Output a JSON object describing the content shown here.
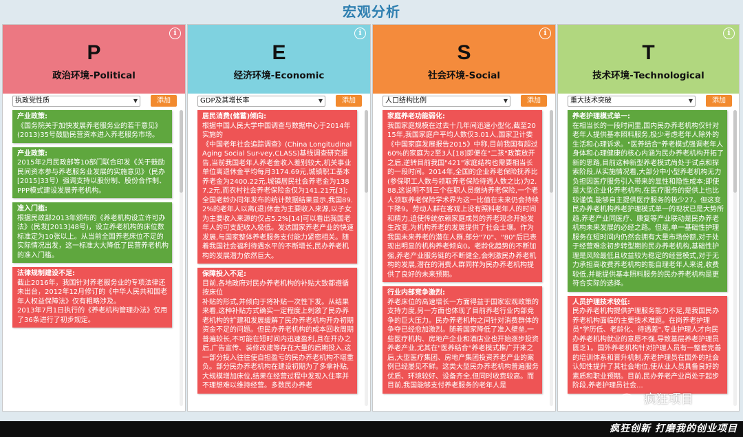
{
  "page": {
    "title": "宏观分析"
  },
  "colors": {
    "political": "#ec7882",
    "economic": "#7fd2e0",
    "social": "#f48b3c",
    "technological": "#b1d77f",
    "card_green": "#5fa73e",
    "card_red": "#ee5455",
    "button": "#f28a2e"
  },
  "columns": [
    {
      "letter": "P",
      "subtitle": "政治环境-Political",
      "select_value": "执政党性质",
      "add_label": "添加",
      "cards": [
        {
          "color": "green",
          "title": "产业政策:",
          "body": "《国务院关于加快发展养老服务业的若干意见》(2013)35号鼓励民营资本进入养老服务市场。"
        },
        {
          "color": "green",
          "title": "产业政策:",
          "body": "2015年2月民政部等10部门联合印发《关于鼓励民间资本参与养老服务业发展的实施意见》（民办[2015]33号）强调支持以股份制、股份合作制、PPP模式建设发展养老机构。"
        },
        {
          "color": "green",
          "title": "准入门槛:",
          "body": "根据民政部2013年颁布的《养老机构设立许可办法》(民发[2013]48号)，设立养老机构的床位数标准定为10张以上。从当前全国养老床位不足的实际情况出发，这一标准大大降低了民营养老机构的准入门槛。"
        },
        {
          "color": "red",
          "title": "法律规制建设不足:",
          "body": "截止2016年，我国针对养老服务业的专项法律还未出台，2012年12月修订的《中华人民共和国老年人权益保障法》仅有粗略涉及。\n2013年7月1日执行的《养老机构管理办法》仅用了36条进行了初步规定。"
        }
      ]
    },
    {
      "letter": "E",
      "subtitle": "经济环境-Economic",
      "select_value": "GDP及其增长率",
      "add_label": "添加",
      "cards": [
        {
          "color": "red",
          "title": "居民消费(储蓄)倾向:",
          "body": "根据中国人民大学中国调查与数据中心于2014年实施的\n《中国老年社会追踪调查》(China Longitudinal Aging Social Sur-vey,CLASS)基线调查研究报告,当前我国老年人养老金收入差别较大,机关事业单位离退休金平均每月3174.69元,城镇职工基本养老金为2400.22元,城镇居民社会养老金为1387.2元,而农村社会养老保险金仅为141.21元[3];全国老龄办同年发布的统计数据结果显示,我国89.2%的老年人以离(退)休金为主要收入来源,以子女为主要收入来源的仅占5.2%[14]可以看出我国老年人的可支配收入极低。发达国家养老产业的快速发展,与国家整体养老服务支付能力紧密相关。随着我国社会福利待遇水平的不断增长,民办养老机构的发展潜力依然巨大。"
        },
        {
          "color": "red",
          "title": "保障投入不足:",
          "body": "目前,各地政府对民办养老机构的补贴大致都遵循按床位\n补贴的形式,并倾向于将补贴一次性下发。从结果来看,这种补贴方式确实一定程度上刺激了民办养老机构的扩建和发展缓解了民办养老机构开办初期资金不足的问题。但民办养老机构的成本回收周期普遍较长,不可能在短时间内迅速盈利,且在开办之后,广告宣传、装修改建等存在大量的后期投入,这一部分投入往往使自担盈亏的民办养老机构不堪重负。部分民办养老机构在建设初期为了多拿补贴,大规模增加床位,结果在经营过程中发现入住率并不理想难以维持经营。多数民办养老"
        }
      ]
    },
    {
      "letter": "S",
      "subtitle": "社会环境-Social",
      "select_value": "人口结构比例",
      "add_label": "添加",
      "cards": [
        {
          "color": "red",
          "title": "家庭养老功能弱化:",
          "body": "我国家庭规模在过去十几年间迅速小型化,截至2015年,我国家庭户平均人数仅3.01人,国家卫计委《中国家庭发展报告2015》中称,目前我国有超过60%的家庭为2至3人[18]即便在\"二孩\"政策放开之后,逆转目前我国\"421\"家庭结构也需要相当长的一段时间。2014年,全国的企业养老保险抚养比(参保职工人数与领取养老保险待遇人数之比)为2.88,这说明不到三个在职人员缴纳养老保险,一个老人领取养老保险学术界为这一比值在未来仍会持续下降9。劳动人群在客观上没有照料老年人的时间和精力,迫使传统依赖家庭成员的养老观念开始发生改变,为机构养老的发展提供了社会土壤。作为我国未来养老的潜在人群,部分\"70\"、\"80\"后已表现出明显的机构养老倾向0。老龄化趋势的不断加强,养老产业服务链的不断健全,会刺激民办养老机构的发展,潜在的消费人群同样为民办养老机构提供了良好的未来预期。"
        },
        {
          "color": "red",
          "title": "行业内部竞争激烈:",
          "body": "养老床位的高速增长一方面得益于国家宏观政策的支持力度,另一方面也体现了目前养老行业内部竞争的巨大压力。民办养老机构之间针对消费群体的争夺已经愈加激烈。随着国家降低了准入壁垒,一些医疗机构、房地产企业和酒店业也开始逐步投资养老产业,尤其在\"医养结合\"养老模式推广开来之后,大型医疗集团、房地产集团投资养老产业的案例已经屡见不鲜。这类大型民办养老机构普遍服务优质、环境较好、设备齐全,但同时收费较高。而目前,我国能够支付养老服务的老年人是"
        }
      ]
    },
    {
      "letter": "T",
      "subtitle": "技术环境-Technological",
      "select_value": "重大技术突破",
      "add_label": "添加",
      "cards": [
        {
          "color": "green",
          "title": "养老护理模式单一:",
          "body": "在相当长的一段时间里,国内民办养老机构仅针对老年人提供基本照料服务,极少考虑老年人除外的生活和心理诉求。\"医养结合\"养老模式强调老年人身体和心理健康的核心内涵为民办养老机构开拓了新的思路,目前这种新型养老模式尚处于试点和探索阶段,从实施情况看,大部分中小型养老机构无力负担因医疗服务引入带来的显性和隐性成本;即使是大型企业化养老机构,在医疗服务的提供上也比较谨慎,能够自主提供医疗服务的极少27。但这变民办养老机构养老护理模式单一的现状已是大势所趋,养老产业同医疗、康复等产业联动是民办养老机构未来发展的必经之路。但是,单一基础性护理服务在短时间内仍然会拥有大量市场份额,对于处于经营难念初步转型期的民办养老机构,基础性护理是风险最低且收益较为稳定的经营模式,对于无力承担高收费养老机构的能自理老年人来说,收费较低,并能提供基本照料服务的民办养老机构是更符合实际的选择。"
        },
        {
          "color": "red",
          "title": "人员护理技术较低:",
          "body": "民办养老机构提供护理服务能力不足,是我国民办养老机构面临的主要技术难题。在岗养老护理员\"学历低、老龄化、待遇差\",专业护理人才向民办养老机构就业的意愿不强,导致基层养老护理员匮乏1。国外养老机构针对护理人员有一整套完善的培训体系和晋升机制,养老护理员在国外的社会认知性提升了其社会地位,使从业人员具备良好的素质和职业预期。目前,民办养老产业尚处于起步阶段,养老护理员社会..."
        }
      ]
    }
  ],
  "watermark": {
    "text": "疯狂项目"
  },
  "footer": {
    "slogan": "疯狂创新    打磨我的创业项目"
  }
}
